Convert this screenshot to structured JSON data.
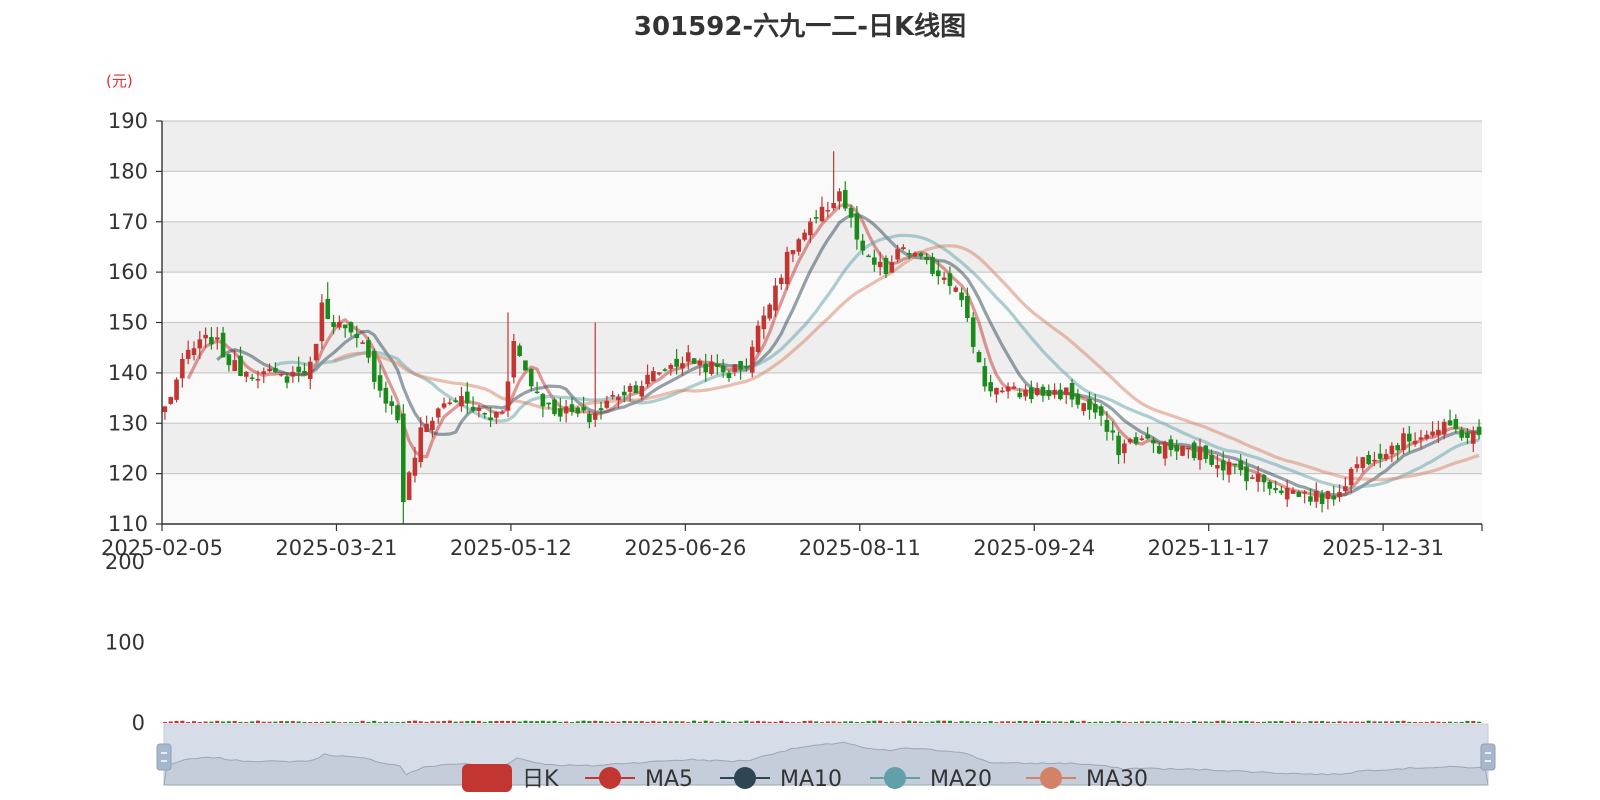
{
  "title": "301592-六九一二-日K线图",
  "unit_label": "(元)",
  "colors": {
    "up": "#c23531",
    "down": "#1a8a1a",
    "ma5": "#c23531",
    "ma10": "#2f4554",
    "ma20": "#61a0a8",
    "ma30": "#d48265"
  },
  "chart_data": {
    "type": "candlestick",
    "x_ticks": [
      "2025-02-05",
      "2025-03-21",
      "2025-05-12",
      "2025-06-26",
      "2025-08-11",
      "2025-09-24",
      "2025-11-17",
      "2025-12-31"
    ],
    "x_tick_positions": [
      0,
      30,
      60,
      90,
      120,
      150,
      180,
      210
    ],
    "num_days": 227,
    "price_axis": {
      "ylim": [
        110,
        190
      ],
      "ticks": [
        110,
        120,
        130,
        140,
        150,
        160,
        170,
        180,
        190
      ]
    },
    "volume_axis": {
      "ylim": [
        0,
        200
      ],
      "ticks": [
        0,
        100,
        200
      ]
    },
    "grid": true,
    "legend_position": "bottom-center",
    "legend": [
      "日K",
      "MA5",
      "MA10",
      "MA20",
      "MA30"
    ],
    "close_anchors": [
      [
        0,
        133
      ],
      [
        4,
        144
      ],
      [
        8,
        147
      ],
      [
        12,
        141
      ],
      [
        16,
        140
      ],
      [
        20,
        139
      ],
      [
        25,
        141
      ],
      [
        27,
        153
      ],
      [
        32,
        147
      ],
      [
        34,
        145
      ],
      [
        37,
        137
      ],
      [
        40,
        131
      ],
      [
        41,
        115
      ],
      [
        44,
        128
      ],
      [
        47,
        133
      ],
      [
        50,
        135
      ],
      [
        53,
        133
      ],
      [
        56,
        131
      ],
      [
        58,
        133
      ],
      [
        60,
        146
      ],
      [
        63,
        138
      ],
      [
        66,
        133
      ],
      [
        70,
        132
      ],
      [
        73,
        131
      ],
      [
        75,
        133
      ],
      [
        78,
        136
      ],
      [
        82,
        138
      ],
      [
        86,
        141
      ],
      [
        90,
        143
      ],
      [
        94,
        141
      ],
      [
        97,
        140
      ],
      [
        100,
        142
      ],
      [
        104,
        155
      ],
      [
        108,
        165
      ],
      [
        112,
        170
      ],
      [
        116,
        176
      ],
      [
        118,
        170
      ],
      [
        120,
        163
      ],
      [
        124,
        160
      ],
      [
        127,
        165
      ],
      [
        130,
        162
      ],
      [
        133,
        160
      ],
      [
        136,
        158
      ],
      [
        138,
        150
      ],
      [
        141,
        138
      ],
      [
        144,
        136
      ],
      [
        150,
        136
      ],
      [
        155,
        136
      ],
      [
        160,
        132
      ],
      [
        164,
        125
      ],
      [
        167,
        127
      ],
      [
        172,
        125
      ],
      [
        178,
        124
      ],
      [
        182,
        122
      ],
      [
        186,
        120
      ],
      [
        190,
        118
      ],
      [
        195,
        116
      ],
      [
        200,
        115
      ],
      [
        202,
        117
      ],
      [
        205,
        122
      ],
      [
        208,
        124
      ],
      [
        212,
        126
      ],
      [
        216,
        128
      ],
      [
        221,
        129
      ],
      [
        226,
        127
      ]
    ],
    "spikes": [
      [
        28,
        158
      ],
      [
        41,
        110
      ],
      [
        42,
        116
      ],
      [
        59,
        152
      ],
      [
        74,
        150
      ],
      [
        115,
        184
      ]
    ],
    "series": [
      {
        "name": "日K",
        "kind": "candlestick"
      },
      {
        "name": "MA5",
        "period": 5
      },
      {
        "name": "MA10",
        "period": 10
      },
      {
        "name": "MA20",
        "period": 20
      },
      {
        "name": "MA30",
        "period": 30
      }
    ]
  }
}
